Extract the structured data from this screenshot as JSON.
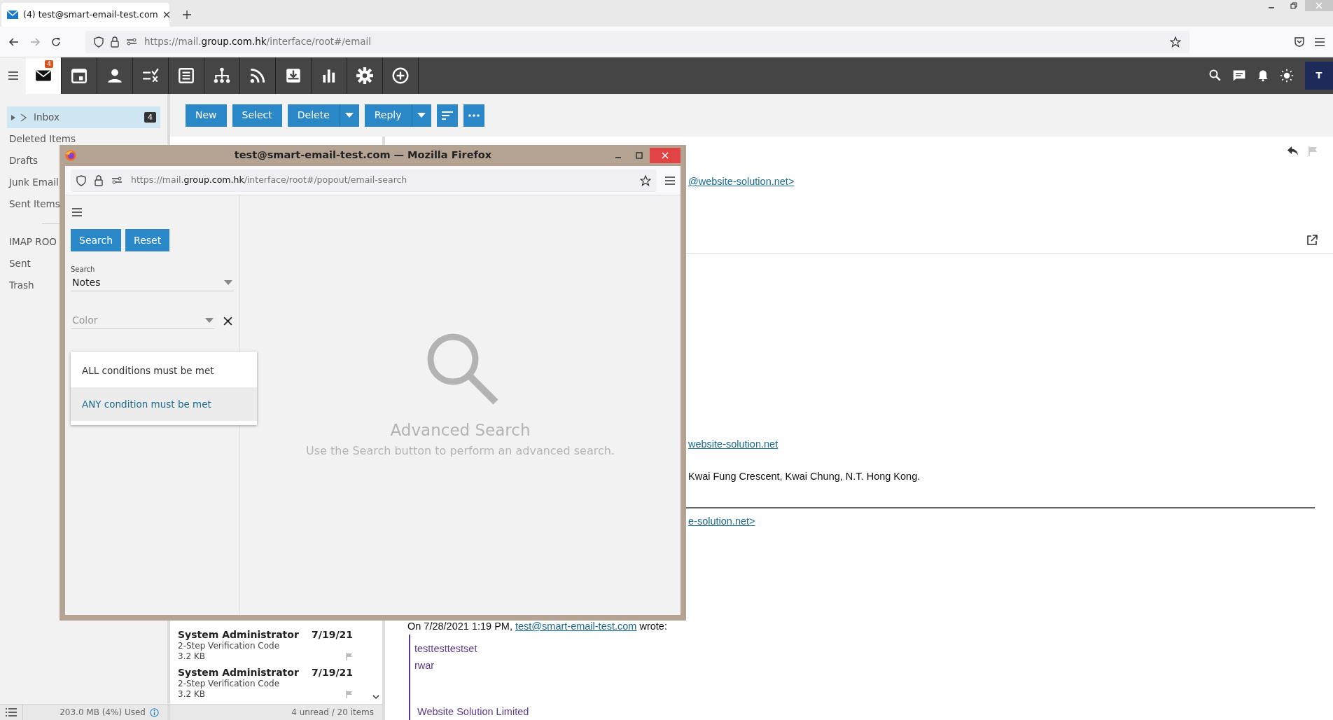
{
  "browser": {
    "tab_title": "(4) test@smart-email-test.com",
    "url": "https://mail.**group.com.hk**/interface/root#/email"
  },
  "app_nav": {
    "mail_badge": "4",
    "avatar": "T"
  },
  "toolbar": {
    "buttons": [
      {
        "label": "New",
        "kind": "plain"
      },
      {
        "label": "Select",
        "kind": "plain"
      },
      {
        "label": "Delete",
        "kind": "split"
      },
      {
        "label": "Reply",
        "kind": "split"
      }
    ]
  },
  "folders": [
    {
      "label": "Inbox",
      "count": "4",
      "selected": true
    },
    {
      "label": "Deleted Items",
      "selected": false
    },
    {
      "label": "Drafts",
      "selected": false
    },
    {
      "label": "Junk Email",
      "selected": false
    },
    {
      "label": "Sent Items",
      "selected": false
    }
  ],
  "imap": {
    "label": "IMAP ROO",
    "folders": [
      {
        "label": "Sent",
        "selected": false
      },
      {
        "label": "Trash",
        "selected": false
      }
    ]
  },
  "storage": "203.0 MB (4%) Used",
  "messages": [
    {
      "sender": "System Administrator",
      "date": "7/19/21",
      "subject": "2-Step Verification Code",
      "size": "3.2 KB"
    },
    {
      "sender": "System Administrator",
      "date": "7/19/21",
      "subject": "2-Step Verification Code",
      "size": "3.2 KB"
    }
  ],
  "list_status": "4 unread / 20 items",
  "reading_pane": {
    "from_link": "@website-solution.net>",
    "body": [
      {
        "kind": "link",
        "text": "website-solution.net"
      },
      {
        "kind": "text",
        "text": "Kwai Fung Crescent, Kwai Chung, N.T. Hong Kong."
      },
      {
        "kind": "rule"
      },
      {
        "kind": "link",
        "text": "e-solution.net>"
      }
    ],
    "quote": {
      "prefix": "On 7/28/2021 1:19 PM,",
      "link": "test@smart-email-test.com",
      "suffix": "wrote:",
      "lines": [
        "testtesttestset",
        "rwar"
      ],
      "signature": "Website Solution Limited"
    }
  },
  "popup": {
    "title": "test@smart-email-test.com — Mozilla Firefox",
    "url": "https://mail.**group.com.hk**/interface/root#/popout/email-search",
    "buttons": [
      "Search",
      "Reset"
    ],
    "search_field": {
      "label": "Search",
      "value": "Notes"
    },
    "color_field": {
      "placeholder": "Color"
    },
    "match_options": [
      {
        "label": "ALL conditions must be met",
        "selected": false
      },
      {
        "label": "ANY condition must be met",
        "selected": true
      }
    ],
    "empty_title": "Advanced Search",
    "empty_hint": "Use the Search button to perform an advanced search."
  }
}
